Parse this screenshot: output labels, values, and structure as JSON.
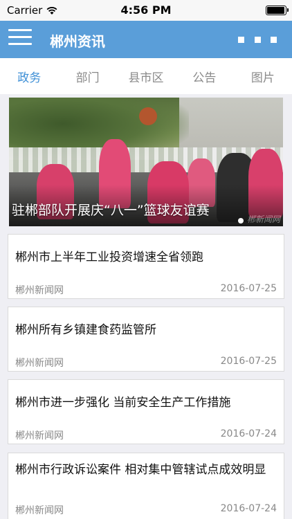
{
  "status_bar": {
    "carrier": "Carrier",
    "time": "4:56 PM",
    "battery_level": 1.0
  },
  "nav_bar": {
    "title": "郴州资讯",
    "background_color": "#5a9ed9",
    "menu_icon": "hamburger-menu-icon",
    "more_icon": "more-dots-icon"
  },
  "tabs": [
    {
      "label": "政务",
      "active": true
    },
    {
      "label": "部门",
      "active": false
    },
    {
      "label": "县市区",
      "active": false
    },
    {
      "label": "公告",
      "active": false
    },
    {
      "label": "图片",
      "active": false
    }
  ],
  "banner": {
    "caption": "驻郴部队开展庆“八一”篮球友谊赛",
    "watermark": "郴新闻网"
  },
  "news": [
    {
      "title": "郴州市上半年工业投资增速全省领跑",
      "source": "郴州新闻网",
      "date": "2016-07-25"
    },
    {
      "title": "郴州所有乡镇建食药监管所",
      "source": "郴州新闻网",
      "date": "2016-07-25"
    },
    {
      "title": "郴州市进一步强化 当前安全生产工作措施",
      "source": "郴州新闻网",
      "date": "2016-07-24"
    },
    {
      "title": "郴州市行政诉讼案件 相对集中管辖试点成效明显",
      "source": "郴州新闻网",
      "date": "2016-07-24"
    }
  ]
}
